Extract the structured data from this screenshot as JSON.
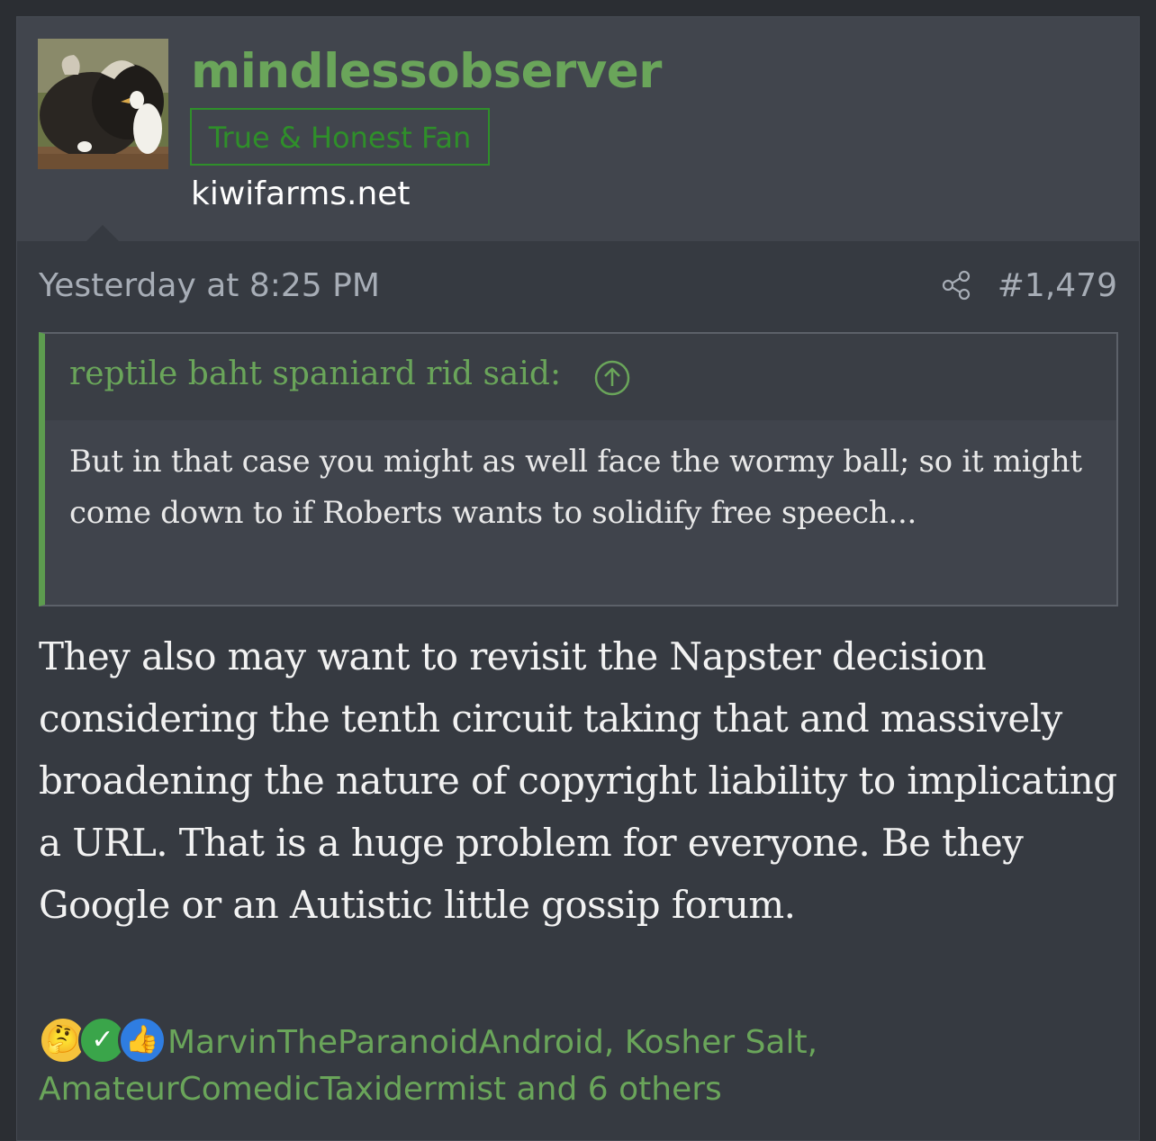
{
  "user": {
    "name": "mindlessobserver",
    "title": "True & Honest Fan",
    "site": "kiwifarms.net",
    "avatar_alt": "avatar"
  },
  "post": {
    "date": "Yesterday at 8:25 PM",
    "number": "#1,479",
    "quote": {
      "author": "reptile baht spaniard rid said:",
      "text": "But in that case you might as well face the wormy ball; so it might come down to if Roberts wants to solidify free speech..."
    },
    "body": "They also may want to revisit the Napster decision considering the tenth circuit taking that and massively broadening the nature of copyright liability to implicating a URL. That is a huge problem for everyone. Be they Google or an Autistic little gossip forum.",
    "reactions": {
      "icons": [
        "thinking-icon",
        "check-icon",
        "thumbs-up-icon"
      ],
      "users": "MarvinTheParanoidAndroid, Kosher Salt, AmateurComedicTaxidermist and 6 others"
    }
  },
  "colors": {
    "accent_green": "#6aa55a",
    "title_green": "#2f8f2a",
    "background": "#363a41"
  }
}
